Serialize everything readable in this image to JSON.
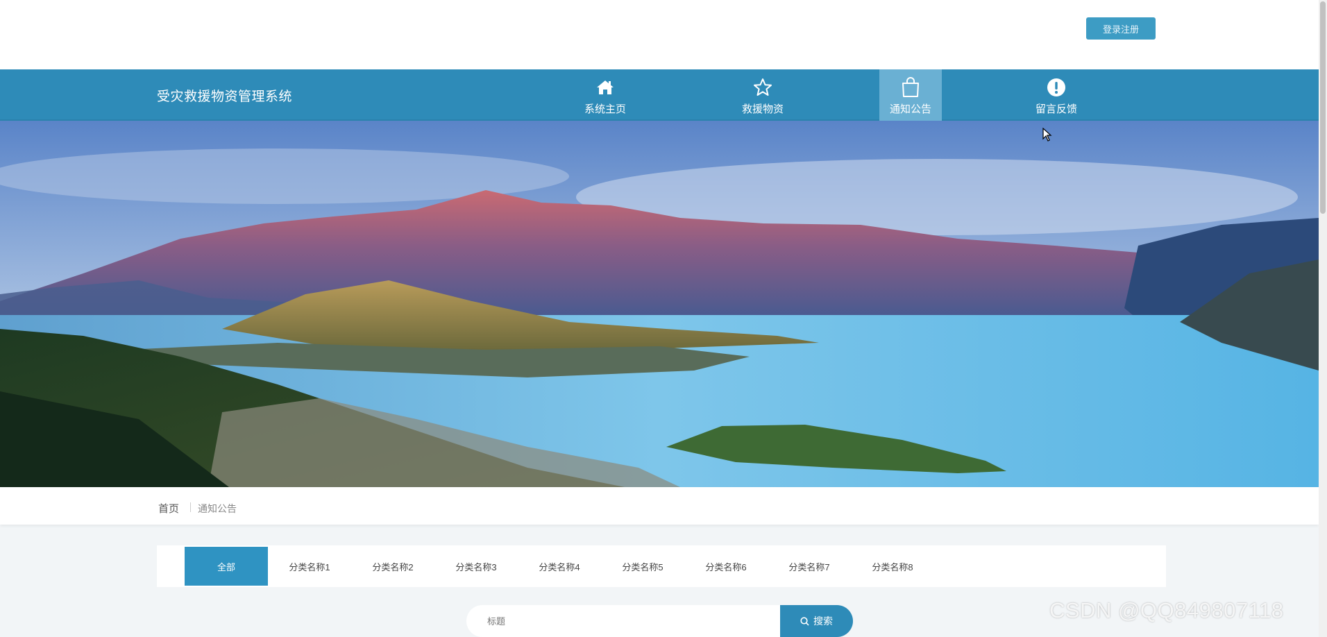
{
  "header": {
    "login_label": "登录注册"
  },
  "navbar": {
    "site_title": "受灾救援物资管理系统",
    "items": [
      {
        "label": "系统主页",
        "icon": "home-icon"
      },
      {
        "label": "救援物资",
        "icon": "star-icon"
      },
      {
        "label": "通知公告",
        "icon": "shopping-bag-icon",
        "active": true
      },
      {
        "label": "留言反馈",
        "icon": "exclamation-circle-icon"
      }
    ]
  },
  "breadcrumb": {
    "home": "首页",
    "current": "通知公告"
  },
  "categories": {
    "active": "全部",
    "tabs": [
      "全部",
      "分类名称1",
      "分类名称2",
      "分类名称3",
      "分类名称4",
      "分类名称5",
      "分类名称6",
      "分类名称7",
      "分类名称8"
    ]
  },
  "search": {
    "placeholder": "标题",
    "button_label": "搜索"
  },
  "watermark": "CSDN @QQ849807118",
  "colors": {
    "primary": "#2e8bb8",
    "active_nav": "#6ab0d3",
    "active_tab": "#2f93c2"
  }
}
